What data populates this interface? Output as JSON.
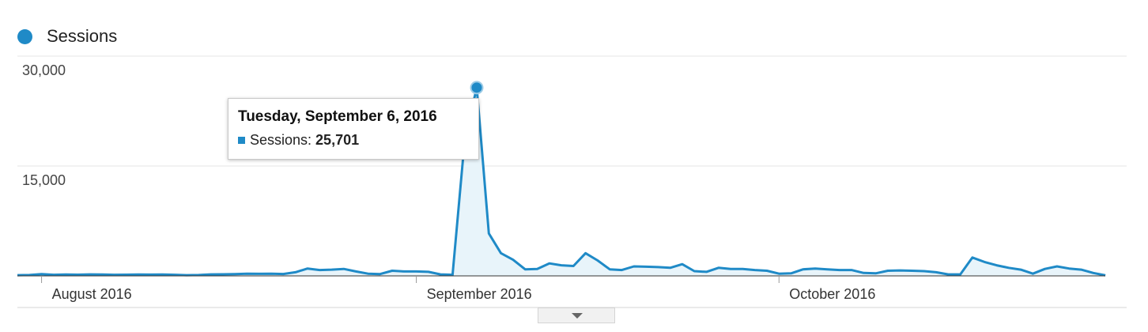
{
  "legend": {
    "label": "Sessions",
    "color": "#1f8ac7"
  },
  "tooltip": {
    "date": "Tuesday, September 6, 2016",
    "metric": "Sessions:",
    "value": "25,701"
  },
  "expand_icon": "chevron-down-icon",
  "chart_data": {
    "type": "area",
    "series": [
      {
        "name": "Sessions",
        "color": "#1f8ac7"
      }
    ],
    "ylim": [
      0,
      30000
    ],
    "y_ticks": [
      {
        "value": 30000,
        "label": "30,000"
      },
      {
        "value": 15000,
        "label": "15,000"
      }
    ],
    "x_ticks": [
      {
        "date": "2016-08-01",
        "label": "August 2016"
      },
      {
        "date": "2016-09-01",
        "label": "September 2016"
      },
      {
        "date": "2016-10-01",
        "label": "October 2016"
      }
    ],
    "highlight": {
      "date": "2016-09-06",
      "value": 25701
    },
    "grid": true,
    "points": [
      {
        "date": "2016-07-30",
        "value": 100
      },
      {
        "date": "2016-07-31",
        "value": 120
      },
      {
        "date": "2016-08-01",
        "value": 250
      },
      {
        "date": "2016-08-02",
        "value": 150
      },
      {
        "date": "2016-08-03",
        "value": 180
      },
      {
        "date": "2016-08-04",
        "value": 160
      },
      {
        "date": "2016-08-05",
        "value": 200
      },
      {
        "date": "2016-08-06",
        "value": 180
      },
      {
        "date": "2016-08-07",
        "value": 150
      },
      {
        "date": "2016-08-08",
        "value": 160
      },
      {
        "date": "2016-08-09",
        "value": 190
      },
      {
        "date": "2016-08-10",
        "value": 170
      },
      {
        "date": "2016-08-11",
        "value": 180
      },
      {
        "date": "2016-08-12",
        "value": 150
      },
      {
        "date": "2016-08-13",
        "value": 100
      },
      {
        "date": "2016-08-14",
        "value": 120
      },
      {
        "date": "2016-08-15",
        "value": 200
      },
      {
        "date": "2016-08-16",
        "value": 220
      },
      {
        "date": "2016-08-17",
        "value": 250
      },
      {
        "date": "2016-08-18",
        "value": 300
      },
      {
        "date": "2016-08-19",
        "value": 280
      },
      {
        "date": "2016-08-20",
        "value": 290
      },
      {
        "date": "2016-08-21",
        "value": 260
      },
      {
        "date": "2016-08-22",
        "value": 500
      },
      {
        "date": "2016-08-23",
        "value": 1000
      },
      {
        "date": "2016-08-24",
        "value": 800
      },
      {
        "date": "2016-08-25",
        "value": 850
      },
      {
        "date": "2016-08-26",
        "value": 950
      },
      {
        "date": "2016-08-27",
        "value": 600
      },
      {
        "date": "2016-08-28",
        "value": 300
      },
      {
        "date": "2016-08-29",
        "value": 250
      },
      {
        "date": "2016-08-30",
        "value": 700
      },
      {
        "date": "2016-08-31",
        "value": 600
      },
      {
        "date": "2016-09-01",
        "value": 600
      },
      {
        "date": "2016-09-02",
        "value": 550
      },
      {
        "date": "2016-09-03",
        "value": 200
      },
      {
        "date": "2016-09-04",
        "value": 150
      },
      {
        "date": "2016-09-05",
        "value": 18500
      },
      {
        "date": "2016-09-06",
        "value": 25701
      },
      {
        "date": "2016-09-07",
        "value": 5800
      },
      {
        "date": "2016-09-08",
        "value": 3100
      },
      {
        "date": "2016-09-09",
        "value": 2200
      },
      {
        "date": "2016-09-10",
        "value": 900
      },
      {
        "date": "2016-09-11",
        "value": 950
      },
      {
        "date": "2016-09-12",
        "value": 1700
      },
      {
        "date": "2016-09-13",
        "value": 1450
      },
      {
        "date": "2016-09-14",
        "value": 1350
      },
      {
        "date": "2016-09-15",
        "value": 3100
      },
      {
        "date": "2016-09-16",
        "value": 2100
      },
      {
        "date": "2016-09-17",
        "value": 900
      },
      {
        "date": "2016-09-18",
        "value": 800
      },
      {
        "date": "2016-09-19",
        "value": 1300
      },
      {
        "date": "2016-09-20",
        "value": 1250
      },
      {
        "date": "2016-09-21",
        "value": 1200
      },
      {
        "date": "2016-09-22",
        "value": 1100
      },
      {
        "date": "2016-09-23",
        "value": 1600
      },
      {
        "date": "2016-09-24",
        "value": 650
      },
      {
        "date": "2016-09-25",
        "value": 550
      },
      {
        "date": "2016-09-26",
        "value": 1100
      },
      {
        "date": "2016-09-27",
        "value": 950
      },
      {
        "date": "2016-09-28",
        "value": 950
      },
      {
        "date": "2016-09-29",
        "value": 800
      },
      {
        "date": "2016-09-30",
        "value": 700
      },
      {
        "date": "2016-10-01",
        "value": 300
      },
      {
        "date": "2016-10-02",
        "value": 350
      },
      {
        "date": "2016-10-03",
        "value": 900
      },
      {
        "date": "2016-10-04",
        "value": 1000
      },
      {
        "date": "2016-10-05",
        "value": 900
      },
      {
        "date": "2016-10-06",
        "value": 800
      },
      {
        "date": "2016-10-07",
        "value": 800
      },
      {
        "date": "2016-10-08",
        "value": 400
      },
      {
        "date": "2016-10-09",
        "value": 350
      },
      {
        "date": "2016-10-10",
        "value": 700
      },
      {
        "date": "2016-10-11",
        "value": 750
      },
      {
        "date": "2016-10-12",
        "value": 700
      },
      {
        "date": "2016-10-13",
        "value": 650
      },
      {
        "date": "2016-10-14",
        "value": 500
      },
      {
        "date": "2016-10-15",
        "value": 200
      },
      {
        "date": "2016-10-16",
        "value": 200
      },
      {
        "date": "2016-10-17",
        "value": 2500
      },
      {
        "date": "2016-10-18",
        "value": 1900
      },
      {
        "date": "2016-10-19",
        "value": 1450
      },
      {
        "date": "2016-10-20",
        "value": 1100
      },
      {
        "date": "2016-10-21",
        "value": 850
      },
      {
        "date": "2016-10-22",
        "value": 300
      },
      {
        "date": "2016-10-23",
        "value": 950
      },
      {
        "date": "2016-10-24",
        "value": 1300
      },
      {
        "date": "2016-10-25",
        "value": 1000
      },
      {
        "date": "2016-10-26",
        "value": 850
      },
      {
        "date": "2016-10-27",
        "value": 400
      },
      {
        "date": "2016-10-28",
        "value": 80
      }
    ]
  }
}
